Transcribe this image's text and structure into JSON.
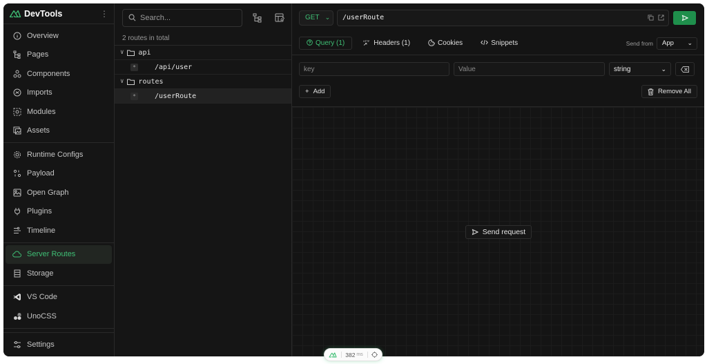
{
  "app": {
    "name": "DevTools",
    "accent": "#3fbf75"
  },
  "sidebar": {
    "groups": [
      [
        {
          "label": "Overview",
          "icon": "info-icon"
        },
        {
          "label": "Pages",
          "icon": "pages-tree-icon"
        },
        {
          "label": "Components",
          "icon": "components-icon"
        },
        {
          "label": "Imports",
          "icon": "imports-icon"
        },
        {
          "label": "Modules",
          "icon": "modules-icon"
        },
        {
          "label": "Assets",
          "icon": "assets-icon"
        }
      ],
      [
        {
          "label": "Runtime Configs",
          "icon": "gear-icon"
        },
        {
          "label": "Payload",
          "icon": "payload-icon"
        },
        {
          "label": "Open Graph",
          "icon": "open-graph-icon"
        },
        {
          "label": "Plugins",
          "icon": "plug-icon"
        },
        {
          "label": "Timeline",
          "icon": "timeline-icon"
        }
      ],
      [
        {
          "label": "Server Routes",
          "icon": "cloud-icon",
          "active": true
        },
        {
          "label": "Storage",
          "icon": "storage-icon"
        }
      ],
      [
        {
          "label": "VS Code",
          "icon": "vscode-icon"
        },
        {
          "label": "UnoCSS",
          "icon": "unocss-icon"
        }
      ]
    ],
    "settings_label": "Settings"
  },
  "routes": {
    "search_placeholder": "Search...",
    "count_text": "2 routes in total",
    "folders": [
      {
        "name": "api",
        "items": [
          {
            "path": "/api/user",
            "badge": "*"
          }
        ]
      },
      {
        "name": "routes",
        "items": [
          {
            "path": "/userRoute",
            "badge": "*",
            "active": true
          }
        ]
      }
    ]
  },
  "request": {
    "method": "GET",
    "url": "/userRoute",
    "tabs": [
      {
        "label": "Query (1)",
        "icon": "question-icon",
        "active": true
      },
      {
        "label": "Headers (1)",
        "icon": "http-icon"
      },
      {
        "label": "Cookies",
        "icon": "cookie-icon"
      },
      {
        "label": "Snippets",
        "icon": "code-icon"
      }
    ],
    "send_from_label": "Send from",
    "send_from_value": "App",
    "param": {
      "key_placeholder": "key",
      "value_placeholder": "Value",
      "type": "string"
    },
    "add_label": "Add",
    "remove_all_label": "Remove All",
    "send_request_label": "Send request"
  },
  "status_pill": {
    "time_value": "382",
    "time_unit": "ms"
  }
}
